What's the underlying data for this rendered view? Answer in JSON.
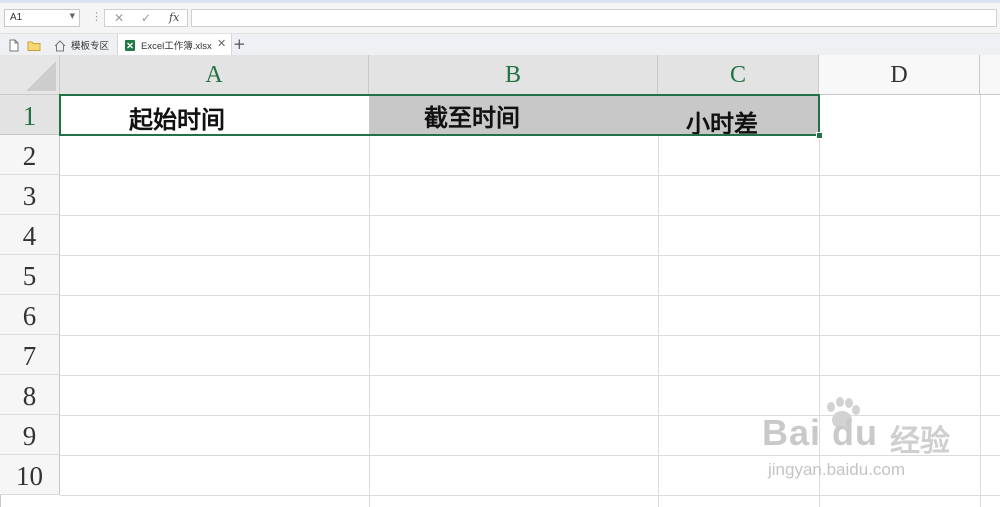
{
  "formula_bar": {
    "name_box": "A1",
    "cancel_glyph": "✕",
    "enter_glyph": "✓",
    "fx_label": "fx",
    "formula_value": ""
  },
  "tabs": {
    "items": [
      {
        "label": "模板专区",
        "icon": "home-icon",
        "active": false
      },
      {
        "label": "Excel工作簿.xlsx",
        "icon": "excel-file-icon",
        "active": true
      }
    ],
    "add_glyph": "+",
    "close_glyph": "✕"
  },
  "grid": {
    "columns": [
      "A",
      "B",
      "C",
      "D"
    ],
    "rows": [
      "1",
      "2",
      "3",
      "4",
      "5",
      "6",
      "7",
      "8",
      "9",
      "10"
    ],
    "cells": {
      "A1": "起始时间",
      "B1": "截至时间",
      "C1": "小时差"
    },
    "selected_range": "A1:C1",
    "header_fill": "#c8c8c8",
    "selection_color": "#217346"
  },
  "watermark": {
    "logo": "Bai du",
    "cn": "经验",
    "url": "jingyan.baidu.com"
  }
}
